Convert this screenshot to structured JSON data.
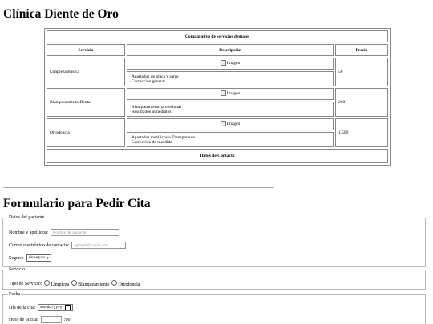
{
  "page_title": "Clínica Diente de Oro",
  "table": {
    "caption": "Comparativa de servicios dentales",
    "headers": [
      "Servicio",
      "Descripción",
      "Precio"
    ],
    "image_alt": "Imagen",
    "rows": [
      {
        "service": "Limpieza Básica",
        "desc": [
          "·Apartados de placa y sarro",
          "·Corrección general"
        ],
        "price": "50"
      },
      {
        "service": "Blanqueamiento Dental",
        "desc": [
          "·Blanqueamiento profesional",
          "·Resultados inmediatos"
        ],
        "price": "200"
      },
      {
        "service": "Ortodoncia",
        "desc": [
          "·Apartados metálicos o Transparente",
          "·Corrección de mordida"
        ],
        "price": "1,500"
      }
    ],
    "contact": "Datos de Contacto"
  },
  "form": {
    "title": "Formulario para Pedir Cita",
    "patient": {
      "legend": "Datos del paciente",
      "name_label": "Nombre y apellidos:",
      "name_placeholder": "Nombre del paciente",
      "email_label": "Correo electrónico de contacto:",
      "email_placeholder": "ejemplo@correo.com",
      "insurance_label": "Seguro:",
      "insurance_value": "sin seguro"
    },
    "service": {
      "legend": "Servicio",
      "label": "Tipo de Servicio:",
      "options": [
        "Limpieza",
        "Blanqueamiento",
        "Ortodoncia"
      ]
    },
    "date": {
      "legend": "Fecha",
      "day_label": "Día de la cita:",
      "day_placeholder": "mm/dd/yyyy",
      "time_label": "Hora de la cita:",
      "time_suffix": ":00"
    }
  }
}
